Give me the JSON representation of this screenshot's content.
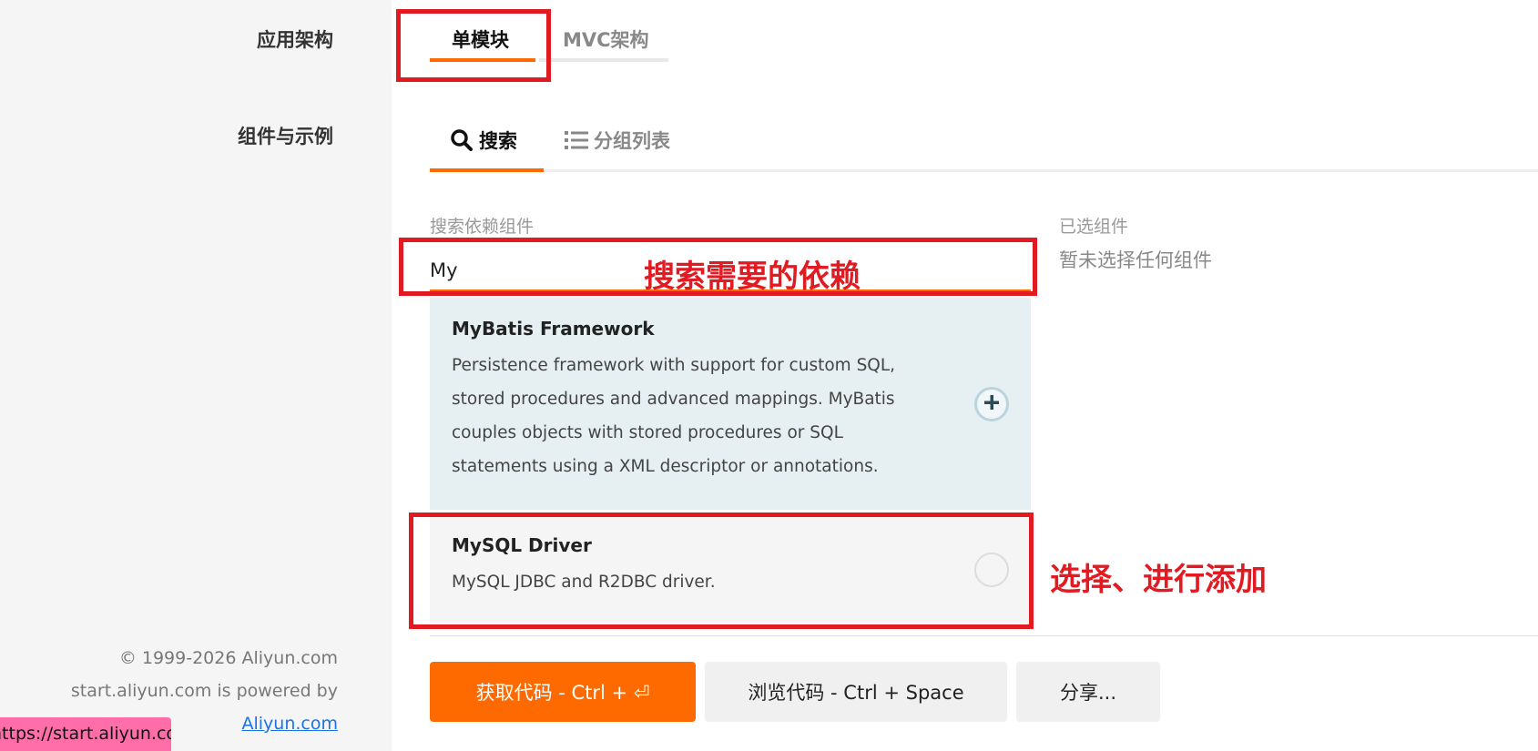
{
  "sidebar": {
    "architecture_label": "应用架构",
    "components_label": "组件与示例",
    "footer": {
      "copyright": "© 1999-2026 Aliyun.com",
      "powered_by": "start.aliyun.com is powered by",
      "link": "Aliyun.com"
    }
  },
  "status_bar": {
    "url": "https://start.aliyun.com"
  },
  "architecture_tabs": [
    {
      "label": "单模块",
      "active": true
    },
    {
      "label": "MVC架构",
      "active": false
    }
  ],
  "component_tabs": [
    {
      "label": "搜索",
      "icon": "search-icon",
      "active": true
    },
    {
      "label": "分组列表",
      "icon": "list-icon",
      "active": false
    }
  ],
  "search": {
    "label": "搜索依赖组件",
    "value": "My"
  },
  "selected": {
    "label": "已选组件",
    "empty_text": "暂未选择任何组件"
  },
  "results": [
    {
      "title": "MyBatis Framework",
      "description": "Persistence framework with support for custom SQL, stored procedures and advanced mappings. MyBatis couples objects with stored procedures or SQL statements using a XML descriptor or annotations.",
      "highlighted": true
    },
    {
      "title": "MySQL Driver",
      "description": "MySQL JDBC and R2DBC driver.",
      "highlighted": false
    }
  ],
  "annotations": {
    "search_note": "搜索需要的依赖",
    "select_note": "选择、进行添加"
  },
  "buttons": {
    "get_code": "获取代码 - Ctrl + ⏎",
    "browse_code": "浏览代码 - Ctrl + Space",
    "share": "分享..."
  },
  "colors": {
    "accent": "#ff6a00",
    "annotation_red": "#e21b23",
    "highlight_bg": "#e6eff2",
    "status_pink": "#ff6ea8"
  }
}
